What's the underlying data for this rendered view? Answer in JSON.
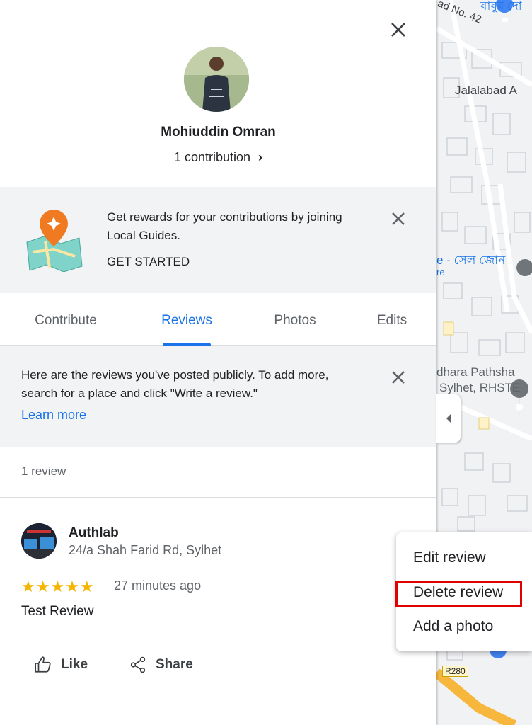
{
  "profile": {
    "name": "Mohiuddin Omran",
    "contributions": "1 contribution"
  },
  "local_guides_banner": {
    "text": "Get rewards for your contributions by joining Local Guides.",
    "cta": "GET STARTED"
  },
  "tabs": [
    {
      "label": "Contribute",
      "active": false
    },
    {
      "label": "Reviews",
      "active": true
    },
    {
      "label": "Photos",
      "active": false
    },
    {
      "label": "Edits",
      "active": false
    }
  ],
  "info_banner": {
    "text": "Here are the reviews you've posted publicly. To add more, search for a place and click \"Write a review.\"",
    "link": "Learn more"
  },
  "reviews_summary": "1 review",
  "review": {
    "place_name": "Authlab",
    "address": "24/a Shah Farid Rd, Sylhet",
    "stars": "★★★★★",
    "rating": 5,
    "time": "27 minutes ago",
    "text": "Test Review",
    "like_label": "Like",
    "share_label": "Share"
  },
  "context_menu": {
    "items": [
      "Edit review",
      "Delete review",
      "Add a photo"
    ],
    "highlighted": "Delete review"
  },
  "map_labels": {
    "top_bengali": "বাবুর দো",
    "road_no": "ad No. 42",
    "jalalabad": "Jalalabad A",
    "bengali_zone": "e - সেল জোন",
    "re": "re",
    "pathsha": "dhara Pathsha",
    "sylhet": "Sylhet, RHSTE",
    "road_shield": "R280"
  },
  "colors": {
    "accent": "#1a73e8",
    "star": "#f4b400",
    "highlight_outline": "#e00000",
    "guides_orange": "#f07a22"
  }
}
